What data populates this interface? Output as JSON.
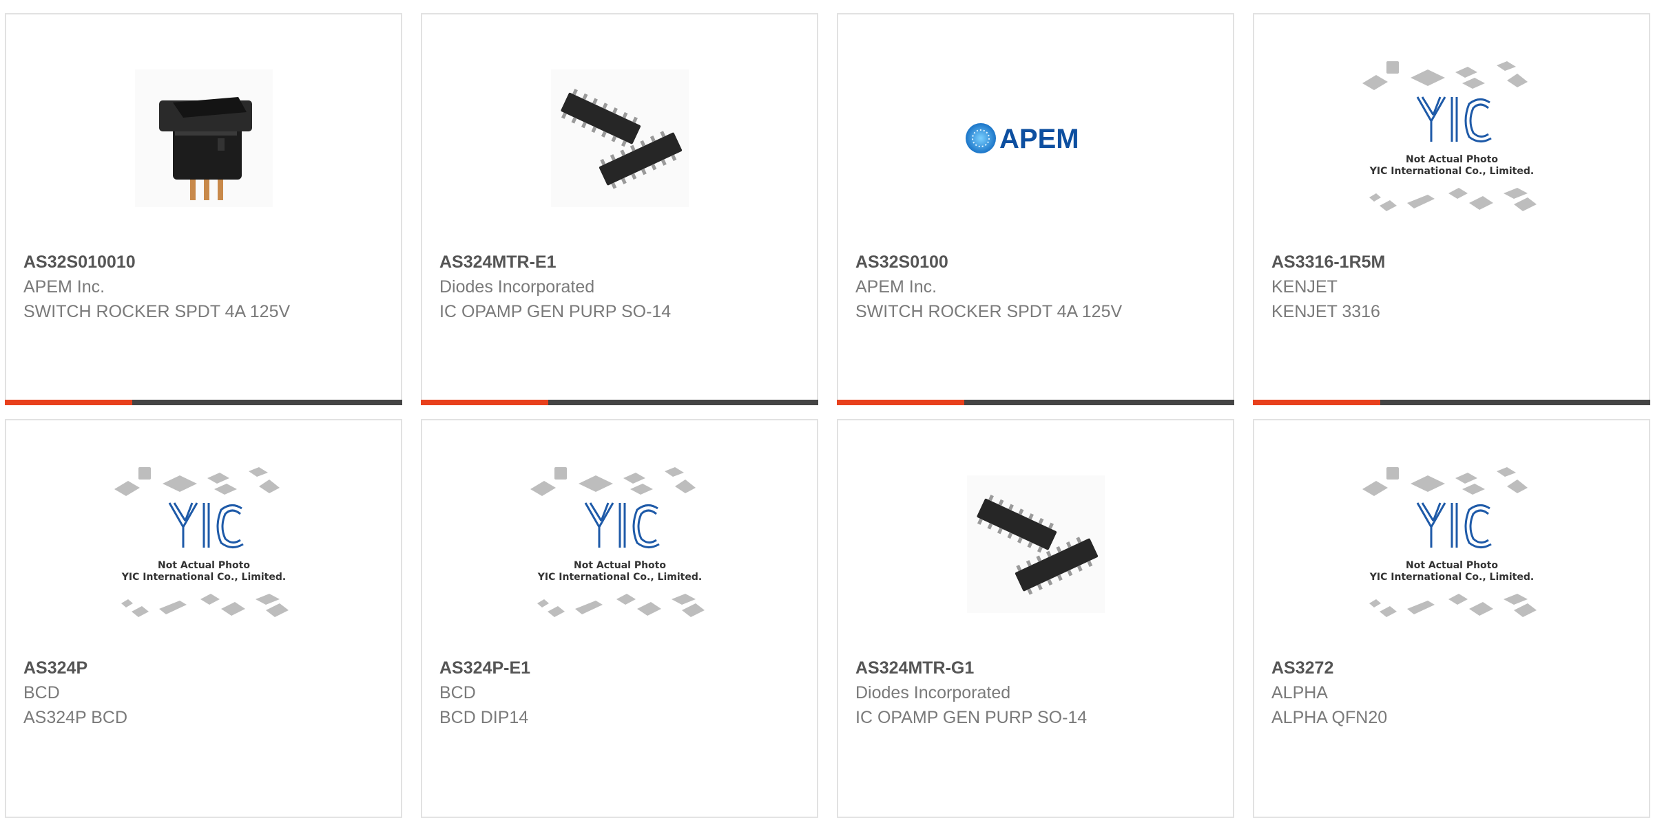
{
  "colors": {
    "accent": "#e8401c",
    "bar": "#444444",
    "card_border": "#e2e2e2"
  },
  "placeholder": {
    "brand": "YIC",
    "line1": "Not Actual Photo",
    "line2": "YIC International Co., Limited."
  },
  "apem_logo_text": "APEM",
  "products": [
    {
      "part": "AS32S010010",
      "manufacturer": "APEM Inc.",
      "description": "SWITCH ROCKER SPDT 4A 125V",
      "image": "rocker-switch-photo"
    },
    {
      "part": "AS324MTR-E1",
      "manufacturer": "Diodes Incorporated",
      "description": "IC OPAMP GEN PURP SO-14",
      "image": "soic-chip-photo"
    },
    {
      "part": "AS32S0100",
      "manufacturer": "APEM Inc.",
      "description": "SWITCH ROCKER SPDT 4A 125V",
      "image": "apem-logo"
    },
    {
      "part": "AS3316-1R5M",
      "manufacturer": "KENJET",
      "description": "KENJET 3316",
      "image": "not-actual-photo-placeholder"
    },
    {
      "part": "AS324P",
      "manufacturer": "BCD",
      "description": "AS324P BCD",
      "image": "not-actual-photo-placeholder"
    },
    {
      "part": "AS324P-E1",
      "manufacturer": "BCD",
      "description": "BCD DIP14",
      "image": "not-actual-photo-placeholder"
    },
    {
      "part": "AS324MTR-G1",
      "manufacturer": "Diodes Incorporated",
      "description": "IC OPAMP GEN PURP SO-14",
      "image": "soic-chip-photo"
    },
    {
      "part": "AS3272",
      "manufacturer": "ALPHA",
      "description": "ALPHA QFN20",
      "image": "not-actual-photo-placeholder"
    }
  ]
}
